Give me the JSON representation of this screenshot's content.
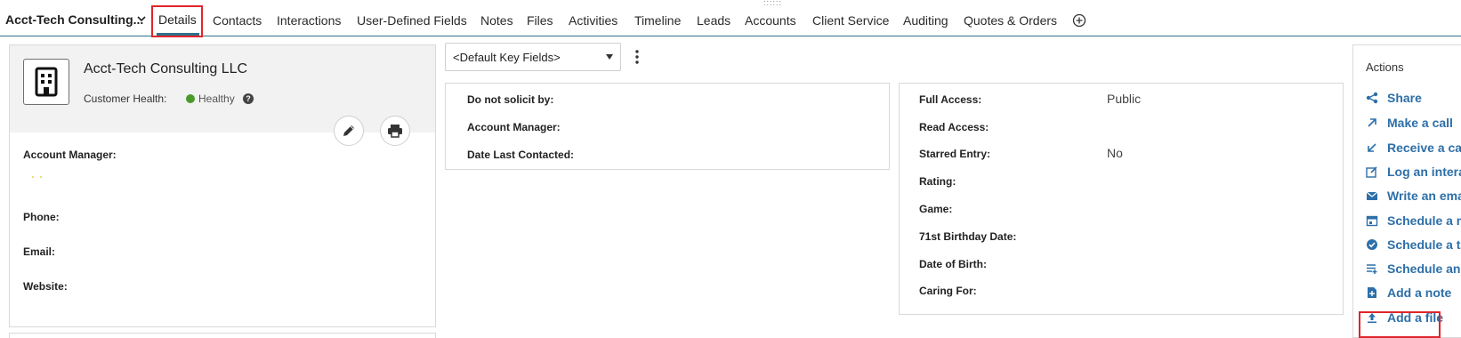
{
  "header": {
    "account_title": "Acct-Tech Consulting...",
    "grip": "::::::",
    "tabs": {
      "details": "Details",
      "contacts": "Contacts",
      "interactions": "Interactions",
      "user_defined_fields": "User-Defined Fields",
      "notes": "Notes",
      "files": "Files",
      "activities": "Activities",
      "timeline": "Timeline",
      "leads": "Leads",
      "accounts": "Accounts",
      "client_service": "Client Service",
      "auditing": "Auditing",
      "quotes_orders": "Quotes & Orders"
    }
  },
  "card": {
    "company_name": "Acct-Tech Consulting LLC",
    "health_label": "Customer Health:",
    "health_value": "Healthy",
    "health_color": "#4a9a2a",
    "help_glyph": "?",
    "fields": {
      "account_manager": "Account Manager:",
      "phone": "Phone:",
      "email": "Email:",
      "website": "Website:"
    }
  },
  "key_fields": {
    "selected": "<Default Key Fields>"
  },
  "panel_a": {
    "do_not_solicit": "Do not solicit by:",
    "account_manager": "Account Manager:",
    "date_last_contacted": "Date Last Contacted:"
  },
  "panel_b": {
    "full_access": "Full Access:",
    "full_access_value": "Public",
    "read_access": "Read Access:",
    "starred_entry": "Starred Entry:",
    "starred_entry_value": "No",
    "rating": "Rating:",
    "game": "Game:",
    "birthday_71st": "71st Birthday Date:",
    "date_of_birth": "Date of Birth:",
    "caring_for": "Caring For:"
  },
  "actions": {
    "title": "Actions",
    "items": {
      "share": "Share",
      "make_call": "Make a call",
      "receive_call": "Receive a call",
      "log_interaction": "Log an interaction",
      "write_email": "Write an email",
      "schedule_meeting": "Schedule a meeting",
      "schedule_todo": "Schedule a to-do",
      "schedule_event": "Schedule an event",
      "add_note": "Add a note",
      "add_file": "Add a file"
    },
    "link_color": "#2d6fa8"
  },
  "highlight_color": "#e0252c"
}
